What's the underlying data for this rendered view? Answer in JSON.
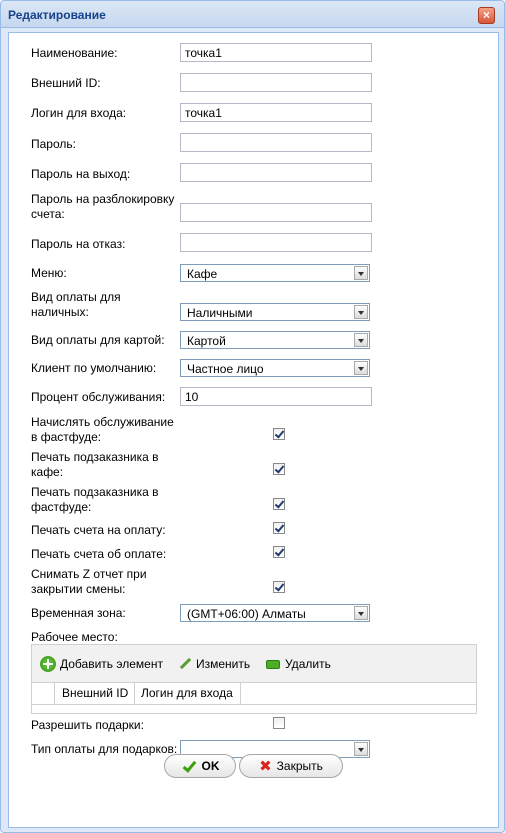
{
  "window": {
    "title": "Редактирование"
  },
  "form": {
    "name_label": "Наименование:",
    "name_value": "точка1",
    "external_id_label": "Внешний ID:",
    "external_id_value": "",
    "login_label": "Логин для входа:",
    "login_value": "точка1",
    "password_label": "Пароль:",
    "password_value": "",
    "exit_password_label": "Пароль на выход:",
    "exit_password_value": "",
    "unlock_password_label_1": "Пароль на разблокировку",
    "unlock_password_label_2": "счета:",
    "unlock_password_value": "",
    "refuse_password_label": "Пароль на отказ:",
    "refuse_password_value": "",
    "menu_label": "Меню:",
    "menu_value": "Кафе",
    "cash_payment_label_1": "Вид оплаты для",
    "cash_payment_label_2": "наличных:",
    "cash_payment_value": "Наличными",
    "card_payment_label": "Вид оплаты для картой:",
    "card_payment_value": "Картой",
    "default_client_label": "Клиент по умолчанию:",
    "default_client_value": "Частное лицо",
    "service_percent_label": "Процент обслуживания:",
    "service_percent_value": "10",
    "fastfood_service_label_1": "Начислять обслуживание",
    "fastfood_service_label_2": "в фастфуде:",
    "fastfood_service_checked": true,
    "print_sub_cafe_label_1": "Печать подзаказника в",
    "print_sub_cafe_label_2": "кафе:",
    "print_sub_cafe_checked": true,
    "print_sub_fastfood_label_1": "Печать подзаказника в",
    "print_sub_fastfood_label_2": "фастфуде:",
    "print_sub_fastfood_checked": true,
    "print_invoice_label": "Печать счета на оплату:",
    "print_invoice_checked": true,
    "print_receipt_label": "Печать счета об оплате:",
    "print_receipt_checked": true,
    "z_report_label_1": "Снимать Z отчет при",
    "z_report_label_2": "закрытии смены:",
    "z_report_checked": true,
    "timezone_label": "Временная зона:",
    "timezone_value": "(GMT+06:00) Алматы",
    "workplace_label": "Рабочее место:",
    "allow_gifts_label": "Разрешить подарки:",
    "allow_gifts_checked": false,
    "gift_payment_label": "Тип оплаты для подарков:",
    "gift_payment_value": ""
  },
  "grid": {
    "add_label": "Добавить элемент",
    "edit_label": "Изменить",
    "delete_label": "Удалить",
    "columns": [
      "Внешний ID",
      "Логин для входа"
    ]
  },
  "buttons": {
    "ok_label": "OK",
    "close_label": "Закрыть"
  }
}
